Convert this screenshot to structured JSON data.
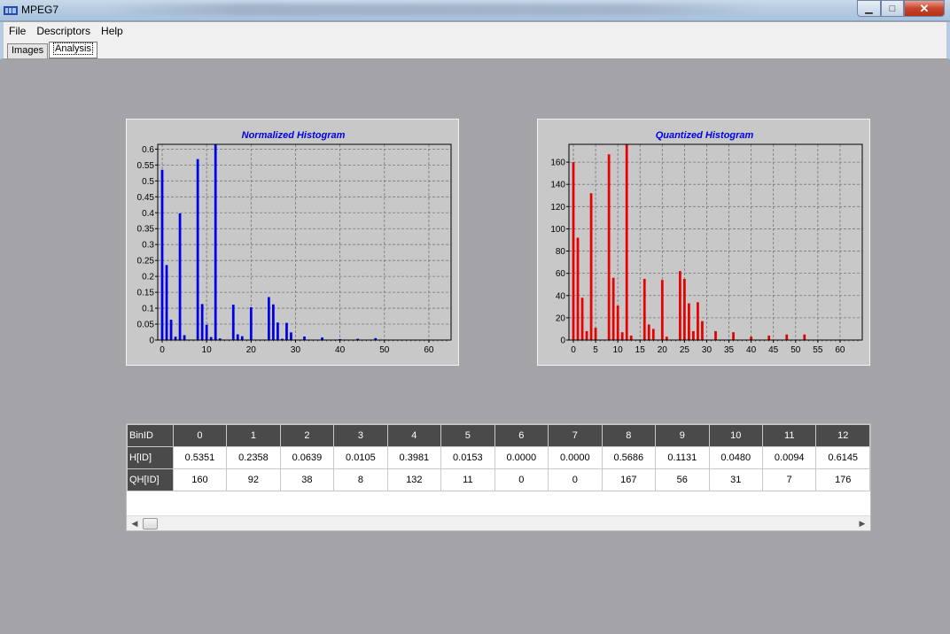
{
  "window": {
    "title": "MPEG7"
  },
  "menu": [
    "File",
    "Descriptors",
    "Help"
  ],
  "tabs": [
    {
      "label": "Images",
      "active": false
    },
    {
      "label": "Analysis",
      "active": true
    }
  ],
  "charts": {
    "normalized": {
      "title": "Normalized Histogram",
      "color": "#0000e6",
      "type": "bar",
      "ylim": [
        0,
        0.615
      ],
      "yticks": [
        "0",
        "0.05",
        "0.1",
        "0.15",
        "0.2",
        "0.25",
        "0.3",
        "0.35",
        "0.4",
        "0.45",
        "0.5",
        "0.55",
        "0.6"
      ],
      "xlim": [
        -1,
        65
      ],
      "xticks": [
        "0",
        "10",
        "20",
        "30",
        "40",
        "50",
        "60"
      ]
    },
    "quantized": {
      "title": "Quantized Histogram",
      "color": "#e60000",
      "type": "bar",
      "ylim": [
        0,
        176
      ],
      "yticks": [
        "0",
        "20",
        "40",
        "60",
        "80",
        "100",
        "120",
        "140",
        "160"
      ],
      "xlim": [
        -1,
        65
      ],
      "xticks": [
        "0",
        "5",
        "10",
        "15",
        "20",
        "25",
        "30",
        "35",
        "40",
        "45",
        "50",
        "55",
        "60"
      ]
    }
  },
  "chart_data": [
    {
      "type": "bar",
      "title": "Normalized Histogram",
      "x": [
        0,
        1,
        2,
        3,
        4,
        5,
        6,
        7,
        8,
        9,
        10,
        11,
        12,
        13,
        14,
        15,
        16,
        17,
        18,
        19,
        20,
        21,
        22,
        23,
        24,
        25,
        26,
        27,
        28,
        29,
        30,
        31,
        32,
        33,
        34,
        35,
        36,
        37,
        38,
        39,
        40,
        41,
        42,
        43,
        44,
        45,
        46,
        47,
        48,
        49,
        50,
        51,
        52,
        53,
        54,
        55,
        56,
        57,
        58,
        59,
        60,
        61,
        62,
        63
      ],
      "values": [
        0.5351,
        0.2358,
        0.0639,
        0.0105,
        0.3981,
        0.0153,
        0.0,
        0.0,
        0.5686,
        0.1131,
        0.048,
        0.0094,
        0.6145,
        0.005,
        0.0,
        0.0,
        0.111,
        0.018,
        0.012,
        0.0,
        0.103,
        0.0,
        0.0,
        0.0,
        0.135,
        0.112,
        0.055,
        0.004,
        0.054,
        0.024,
        0.0,
        0.0,
        0.011,
        0.0,
        0.0,
        0.0,
        0.008,
        0.0,
        0.0,
        0.0,
        0.003,
        0.0,
        0.0,
        0.0,
        0.004,
        0.0,
        0.0,
        0.0,
        0.006,
        0.0,
        0.0,
        0.0,
        0.0,
        0.0,
        0.0,
        0.0,
        0.0,
        0.0,
        0.0,
        0.0,
        0.0,
        0.0,
        0.0,
        0.0
      ],
      "ylim": [
        0,
        0.615
      ],
      "xlim": [
        -1,
        65
      ]
    },
    {
      "type": "bar",
      "title": "Quantized Histogram",
      "x": [
        0,
        1,
        2,
        3,
        4,
        5,
        6,
        7,
        8,
        9,
        10,
        11,
        12,
        13,
        14,
        15,
        16,
        17,
        18,
        19,
        20,
        21,
        22,
        23,
        24,
        25,
        26,
        27,
        28,
        29,
        30,
        31,
        32,
        33,
        34,
        35,
        36,
        37,
        38,
        39,
        40,
        41,
        42,
        43,
        44,
        45,
        46,
        47,
        48,
        49,
        50,
        51,
        52,
        53,
        54,
        55,
        56,
        57,
        58,
        59,
        60,
        61,
        62,
        63
      ],
      "values": [
        160,
        92,
        38,
        8,
        132,
        11,
        0,
        0,
        167,
        56,
        31,
        7,
        176,
        4,
        0,
        0,
        55,
        14,
        10,
        0,
        54,
        3,
        0,
        0,
        62,
        55,
        33,
        8,
        34,
        17,
        0,
        0,
        8,
        0,
        0,
        0,
        7,
        0,
        0,
        0,
        3,
        0,
        0,
        0,
        4,
        0,
        0,
        0,
        5,
        0,
        0,
        0,
        5,
        0,
        0,
        0,
        0,
        0,
        0,
        0,
        0,
        0,
        0,
        0
      ],
      "ylim": [
        0,
        176
      ],
      "xlim": [
        -1,
        65
      ]
    }
  ],
  "table": {
    "header_label": "BinID",
    "columns": [
      "0",
      "1",
      "2",
      "3",
      "4",
      "5",
      "6",
      "7",
      "8",
      "9",
      "10",
      "11",
      "12"
    ],
    "rows": [
      {
        "label": "H[ID]",
        "values": [
          "0.5351",
          "0.2358",
          "0.0639",
          "0.0105",
          "0.3981",
          "0.0153",
          "0.0000",
          "0.0000",
          "0.5686",
          "0.1131",
          "0.0480",
          "0.0094",
          "0.6145"
        ]
      },
      {
        "label": "QH[ID]",
        "values": [
          "160",
          "92",
          "38",
          "8",
          "132",
          "11",
          "0",
          "0",
          "167",
          "56",
          "31",
          "7",
          "176"
        ]
      }
    ]
  }
}
